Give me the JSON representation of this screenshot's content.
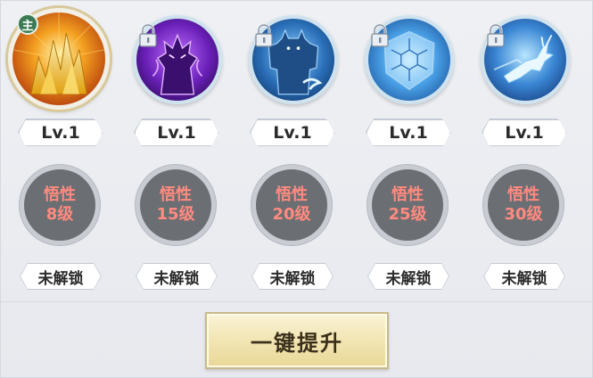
{
  "main_badge": "主",
  "skills": [
    {
      "level": "Lv.1",
      "req_top": "悟性",
      "req_bottom": "8级",
      "status": "未解锁",
      "locked": false,
      "main": true
    },
    {
      "level": "Lv.1",
      "req_top": "悟性",
      "req_bottom": "15级",
      "status": "未解锁",
      "locked": true,
      "main": false
    },
    {
      "level": "Lv.1",
      "req_top": "悟性",
      "req_bottom": "20级",
      "status": "未解锁",
      "locked": true,
      "main": false
    },
    {
      "level": "Lv.1",
      "req_top": "悟性",
      "req_bottom": "25级",
      "status": "未解锁",
      "locked": true,
      "main": false
    },
    {
      "level": "Lv.1",
      "req_top": "悟性",
      "req_bottom": "30级",
      "status": "未解锁",
      "locked": true,
      "main": false
    }
  ],
  "icons": [
    "golden-crystal-icon",
    "purple-demon-icon",
    "blue-golem-icon",
    "turtle-shell-icon",
    "leaping-deer-icon"
  ],
  "upgrade_button": "一键提升",
  "colors": {
    "requirement_text": "#ff8a80",
    "button_gold": "#f1e4b0"
  }
}
